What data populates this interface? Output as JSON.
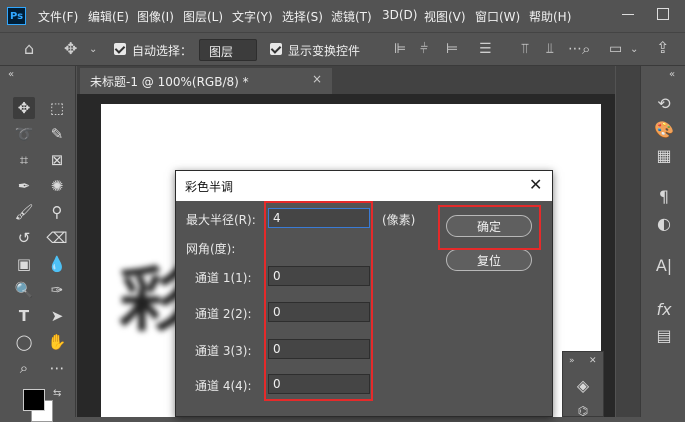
{
  "app": {
    "logo": "Ps"
  },
  "menubar": {
    "items": [
      "文件(F)",
      "编辑(E)",
      "图像(I)",
      "图层(L)",
      "文字(Y)",
      "选择(S)",
      "滤镜(T)",
      "3D(D)",
      "视图(V)",
      "窗口(W)",
      "帮助(H)"
    ]
  },
  "options_bar": {
    "auto_select_label": "自动选择：",
    "auto_select_value": "图层",
    "show_transform_label": "显示变换控件"
  },
  "document": {
    "tab_title": "未标题-1 @ 100%(RGB/8) *",
    "tab_close": "×",
    "canvas_text": "彩"
  },
  "dialog": {
    "title": "彩色半调",
    "close": "✕",
    "max_radius_label": "最大半径(R):",
    "max_radius_value": "4",
    "unit_label": "(像素)",
    "screen_angle_label": "网角(度):",
    "channels": [
      {
        "label": "通道 1(1):",
        "value": "0"
      },
      {
        "label": "通道 2(2):",
        "value": "0"
      },
      {
        "label": "通道 3(3):",
        "value": "0"
      },
      {
        "label": "通道 4(4):",
        "value": "0"
      }
    ],
    "ok_label": "确定",
    "reset_label": "复位"
  },
  "colors": {
    "highlight": "#e52a2a",
    "ui_bg": "#535353",
    "canvas": "#ffffff"
  }
}
